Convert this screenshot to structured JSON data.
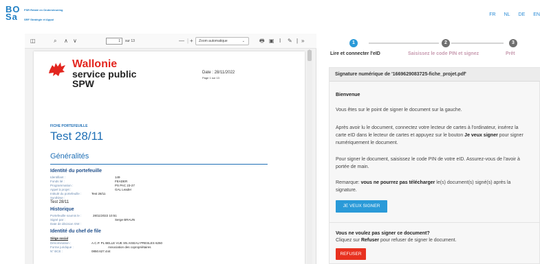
{
  "header": {
    "logo_top": "BO",
    "logo_bottom": "Sa",
    "logo_sub1": "FSR Relaté en Ondersteuning",
    "logo_sub2": "SRF Stratégie et Appui",
    "languages": [
      "FR",
      "NL",
      "DE",
      "EN"
    ]
  },
  "viewer": {
    "toolbar": {
      "page_value": "1",
      "page_count": "sur 13",
      "zoom_label": "Zoom automatique",
      "zoom_minus": "—",
      "zoom_plus": "+"
    },
    "doc": {
      "logo_line1": "Wallonie",
      "logo_line2": "service public",
      "logo_line3": "SPW",
      "date": "Date : 28/11/2022",
      "page": "Page 1 sur 13",
      "fiche_label": "FICHE PORTEFEUILLE",
      "title": "Test 28/11",
      "section_general": "Généralités",
      "identite_title": "Identité du portefeuille",
      "identite_rows": [
        {
          "label": "Identifiant :",
          "value": "149"
        },
        {
          "label": "Fonds lié :",
          "value": "FEADER"
        },
        {
          "label": "Programmation :",
          "value": "PS PAC 23-27"
        },
        {
          "label": "Appel à projet :",
          "value": "GAL Leader"
        },
        {
          "label": "Intitulé du portefeuille :",
          "value": "Test 28/11"
        },
        {
          "label": "Synthèse :",
          "value": ""
        }
      ],
      "synthese_value": "Test 28/11",
      "historique_title": "Historique",
      "historique_rows": [
        {
          "label": "Portefeuille soumis le :",
          "value": "28/11/2022 10:51"
        },
        {
          "label": "Signé par :",
          "value": "Serge BRAUN"
        },
        {
          "label": "Date de décision GW :",
          "value": ""
        }
      ],
      "chef_title": "Identité du chef de file",
      "siege": "Siège social",
      "chef_rows": [
        {
          "label": "Dénomination :",
          "value": "A.C.P. PL BELLE VUE SN AISEAU PRESLES 6250"
        },
        {
          "label": "Forme juridique :",
          "value": "Association des copropriétaires"
        },
        {
          "label": "N° BCE :",
          "value": "0850.627.444"
        }
      ]
    }
  },
  "steps": [
    {
      "number": "1",
      "label": "Lire et connecter l'eID",
      "active": true
    },
    {
      "number": "2",
      "label": "Saisissez le code PIN et signez",
      "active": false
    },
    {
      "number": "3",
      "label": "Prêt",
      "active": false
    }
  ],
  "signature": {
    "heading": "Signature numérique de '1669629083725-fiche_projet.pdf'",
    "welcome": "Bienvenue",
    "p1": "Vous êtes sur le point de signer le document sur la gauche.",
    "p2_a": "Après avoir lu le document, connectez votre lecteur de cartes à l'ordinateur, insérez la carte eID dans le lecteur de cartes et appuyez sur le bouton ",
    "p2_bold": "Je veux signer",
    "p2_b": " pour signer numériquement le document.",
    "p3": "Pour signer le document, saisissez le code PIN de votre eID. Assurez-vous de l'avoir à portée de main.",
    "p4_a": "Remarque: ",
    "p4_bold": "vous ne pourrez pas télécharger",
    "p4_b": " le(s) document(s) signé(s) après la signature.",
    "sign_button": "JE VEUX SIGNER",
    "refuse_q": "Vous ne voulez pas signer ce document?",
    "refuse_a": "Cliquez sur ",
    "refuse_bold": "Refuser",
    "refuse_b": " pour refuser de signer le document.",
    "refuse_button": "REFUSER"
  },
  "colors": {
    "accent": "#2a9ad8",
    "step_active": "#2a9ad8",
    "step_inactive": "#6f6f6f",
    "step_label_inactive": "#c89bb0",
    "refuse": "#e8311f",
    "doc_blue": "#1f6fb5",
    "wallonie_red": "#e3261f"
  }
}
